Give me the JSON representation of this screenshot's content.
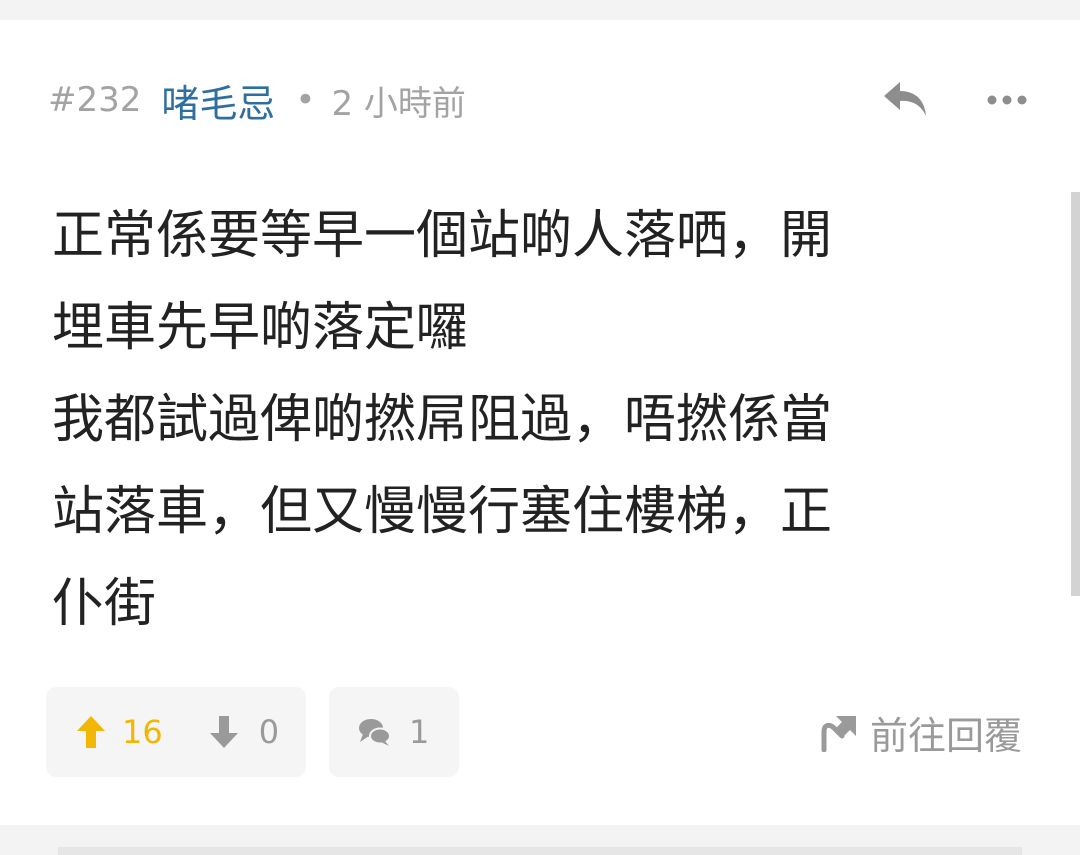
{
  "post": {
    "number": "#232",
    "author": "啫毛忌",
    "separator": "•",
    "time": "2 小時前",
    "lines": [
      "正常係要等早一個站啲人落哂，開",
      "埋車先早啲落定囉",
      "我都試過俾啲撚屌阻過，唔撚係當",
      "站落車，但又慢慢行塞住樓梯，正",
      "仆街"
    ]
  },
  "actions": {
    "upvotes": "16",
    "downvotes": "0",
    "comments": "1",
    "goto_reply_label": "前往回覆"
  },
  "icons": {
    "reply": "reply-icon",
    "more": "more-icon",
    "upvote": "arrow-up-icon",
    "downvote": "arrow-down-icon",
    "comment": "comment-icon",
    "goto_reply": "goto-reply-icon"
  },
  "colors": {
    "author": "#2f6f9f",
    "upvote": "#f2b705",
    "muted": "#9a9a9a",
    "background": "#f3f3f3"
  }
}
